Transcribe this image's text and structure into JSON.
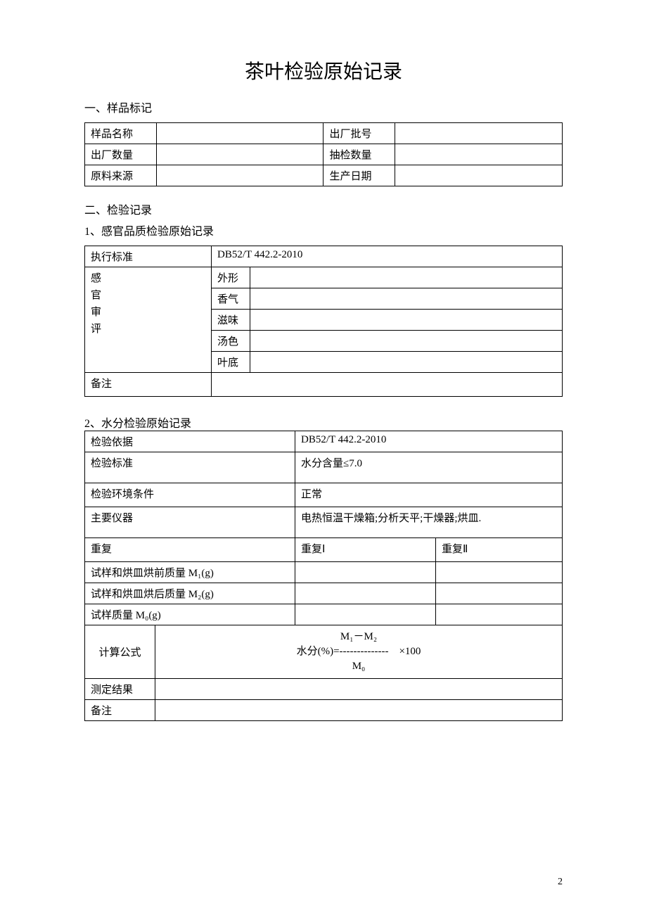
{
  "title": "茶叶检验原始记录",
  "section1": {
    "heading": "一、样品标记",
    "rows": [
      {
        "l1": "样品名称",
        "v1": "",
        "l2": "出厂批号",
        "v2": ""
      },
      {
        "l1": "出厂数量",
        "v1": "",
        "l2": "抽检数量",
        "v2": ""
      },
      {
        "l1": "原料来源",
        "v1": "",
        "l2": "生产日期",
        "v2": ""
      }
    ]
  },
  "section2": {
    "heading": "二、检验记录",
    "part1": {
      "heading": "1、感官品质检验原始记录",
      "std_label": "执行标准",
      "std_value": "DB52/T 442.2-2010",
      "sensory_label": "感\n官\n审\n评",
      "rows": [
        {
          "k": "外形",
          "v": ""
        },
        {
          "k": "香气",
          "v": ""
        },
        {
          "k": "滋味",
          "v": ""
        },
        {
          "k": "汤色",
          "v": ""
        },
        {
          "k": "叶底",
          "v": ""
        }
      ],
      "remark_label": "备注",
      "remark_value": ""
    },
    "part2": {
      "heading": "2、水分检验原始记录",
      "basis_label": "检验依据",
      "basis_value": "DB52/T 442.2-2010",
      "std_label": "检验标准",
      "std_value": "水分含量≤7.0",
      "env_label": "检验环境条件",
      "env_value": "正常",
      "instr_label": "主要仪器",
      "instr_value": "电热恒温干燥箱;分析天平;干燥器;烘皿.",
      "repeat_label": "重复",
      "repeat1": "重复Ⅰ",
      "repeat2": "重复Ⅱ",
      "m1_label": "试样和烘皿烘前质量 M₁(g)",
      "m2_label": "试样和烘皿烘后质量 M₂(g)",
      "m0_label": "试样质量 M₀(g)",
      "formula_label": "计算公式",
      "formula_top": "M₁－M₂",
      "formula_mid": "水分(%)=--------------　×100",
      "formula_bot": "M₀",
      "result_label": "测定结果",
      "result_value": "",
      "remark_label": "备注",
      "remark_value": ""
    }
  },
  "page_number": "2"
}
